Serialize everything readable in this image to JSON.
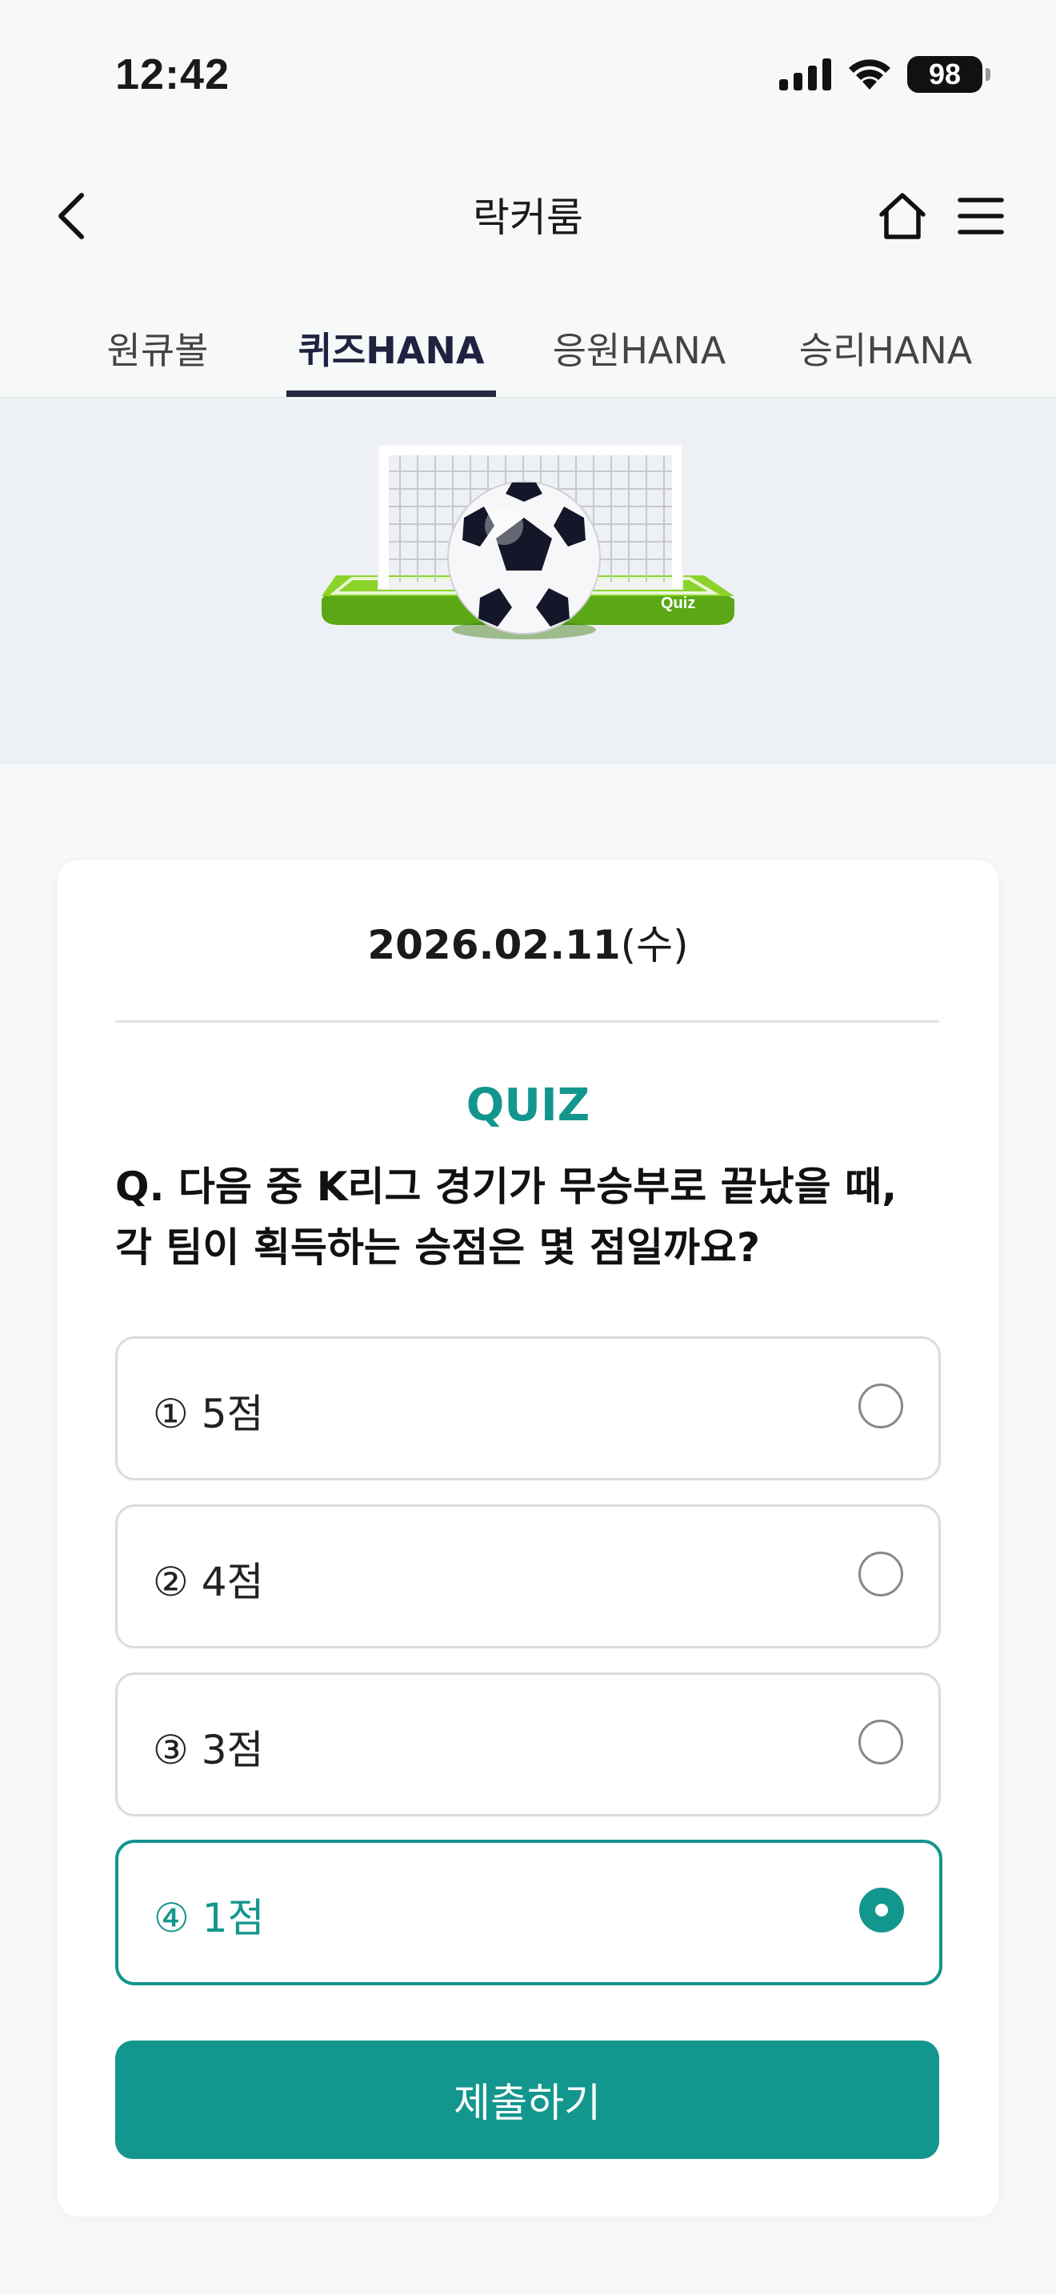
{
  "status_bar": {
    "time": "12:42",
    "battery": "98"
  },
  "nav": {
    "title": "락커룸"
  },
  "tabs": [
    {
      "label": "원큐볼",
      "active": false
    },
    {
      "label": "퀴즈HANA",
      "active": true
    },
    {
      "label": "응원HANA",
      "active": false
    },
    {
      "label": "승리HANA",
      "active": false
    }
  ],
  "hero": {
    "badge_text": "Quiz"
  },
  "quiz": {
    "date": "2026.02.11",
    "day_of_week": "(수)",
    "heading": "QUIZ",
    "question": "Q. 다음 중 K리그 경기가 무승부로 끝났을 때, 각 팀이 획득하는 승점은 몇 점일까요?",
    "options": [
      {
        "label": "① 5점",
        "selected": false
      },
      {
        "label": "② 4점",
        "selected": false
      },
      {
        "label": "③ 3점",
        "selected": false
      },
      {
        "label": "④ 1점",
        "selected": true
      }
    ],
    "submit_label": "제출하기"
  },
  "colors": {
    "accent": "#13968d",
    "tab_active": "#23273f",
    "hero_bg": "#edf0f4"
  },
  "icons": [
    "signal-icon",
    "wifi-icon",
    "battery-icon",
    "back-chevron-icon",
    "home-icon",
    "menu-icon",
    "soccer-goal-illustration"
  ]
}
